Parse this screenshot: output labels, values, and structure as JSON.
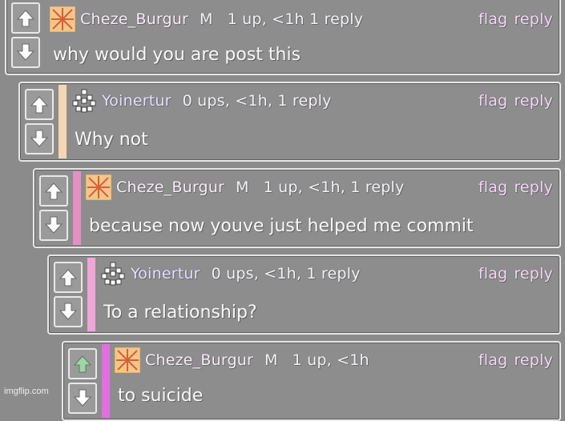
{
  "icons": {
    "upvote": "arrow-up-icon",
    "downvote": "arrow-down-icon"
  },
  "colors": {
    "upvote_active": "#9fd6a6",
    "stripe_1": "#f4d7b3",
    "stripe_2": "#e590c4",
    "stripe_3": "#f1a6d8",
    "stripe_4": "#e070e0"
  },
  "comments": [
    {
      "username": "Cheze_Burgur",
      "gender": "M",
      "meta": "1 up, <1h  1 reply",
      "flag": "flag",
      "reply": "reply",
      "body": "why would you are post this"
    },
    {
      "username": "Yoinertur",
      "gender": "",
      "meta": "0 ups, <1h, 1 reply",
      "flag": "flag",
      "reply": "reply",
      "body": "Why not"
    },
    {
      "username": "Cheze_Burgur",
      "gender": "M",
      "meta": "1 up, <1h, 1 reply",
      "flag": "flag",
      "reply": "reply",
      "body": "because now youve just helped me commit"
    },
    {
      "username": "Yoinertur",
      "gender": "",
      "meta": "0 ups, <1h, 1 reply",
      "flag": "flag",
      "reply": "reply",
      "body": "To a relationship?"
    },
    {
      "username": "Cheze_Burgur",
      "gender": "M",
      "meta": "1 up, <1h",
      "flag": "flag",
      "reply": "reply",
      "body": "to suicide"
    }
  ],
  "watermark": "imgflip.com"
}
